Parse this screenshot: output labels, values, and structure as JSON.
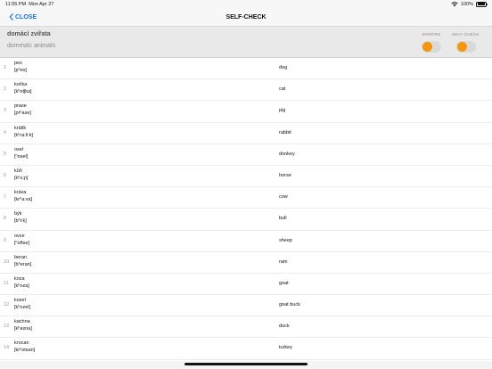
{
  "status_bar": {
    "time": "11:55 PM",
    "date": "Mon Apr 27",
    "battery": "100%"
  },
  "nav": {
    "close_label": "CLOSE",
    "title": "SELF-CHECK"
  },
  "deck": {
    "title": "domácí zvířata",
    "subtitle": "domestic animals",
    "errors_label": "ERRORS",
    "selfcheck_label": "SELF-CHECK"
  },
  "colors": {
    "accent": "#1a72e8",
    "toggle_knob": "#f5960c",
    "header_bg": "#e9e9e9"
  },
  "words": [
    {
      "num": "1",
      "word": "pes",
      "pron": "[pʰes]",
      "trans": "dog"
    },
    {
      "num": "2",
      "word": "kočka",
      "pron": "[kʰotʃka]",
      "trans": "cat"
    },
    {
      "num": "3",
      "word": "prase",
      "pron": "[prʰase]",
      "trans": "pig"
    },
    {
      "num": "4",
      "word": "králík",
      "pron": "[kʰra:li:k]",
      "trans": "rabbit"
    },
    {
      "num": "5",
      "word": "osel",
      "pron": "[ʰosel]",
      "trans": "donkey"
    },
    {
      "num": "6",
      "word": "kůň",
      "pron": "[kʰu:ɲ]",
      "trans": "horse"
    },
    {
      "num": "7",
      "word": "kráva",
      "pron": "[krʰa:va]",
      "trans": "cow"
    },
    {
      "num": "8",
      "word": "býk",
      "pron": "[bʰi:k]",
      "trans": "bull"
    },
    {
      "num": "9",
      "word": "ovce",
      "pron": "[ʰoftse]",
      "trans": "sheep"
    },
    {
      "num": "10",
      "word": "beran",
      "pron": "[bʰeran]",
      "trans": "ram"
    },
    {
      "num": "11",
      "word": "koza",
      "pron": "[kʰoza]",
      "trans": "goat"
    },
    {
      "num": "12",
      "word": "kozel",
      "pron": "[kʰozel]",
      "trans": "goat buck"
    },
    {
      "num": "13",
      "word": "kachna",
      "pron": "[kʰaxna]",
      "trans": "duck"
    },
    {
      "num": "14",
      "word": "krocan",
      "pron": "[krʰotsan]",
      "trans": "turkey"
    }
  ]
}
